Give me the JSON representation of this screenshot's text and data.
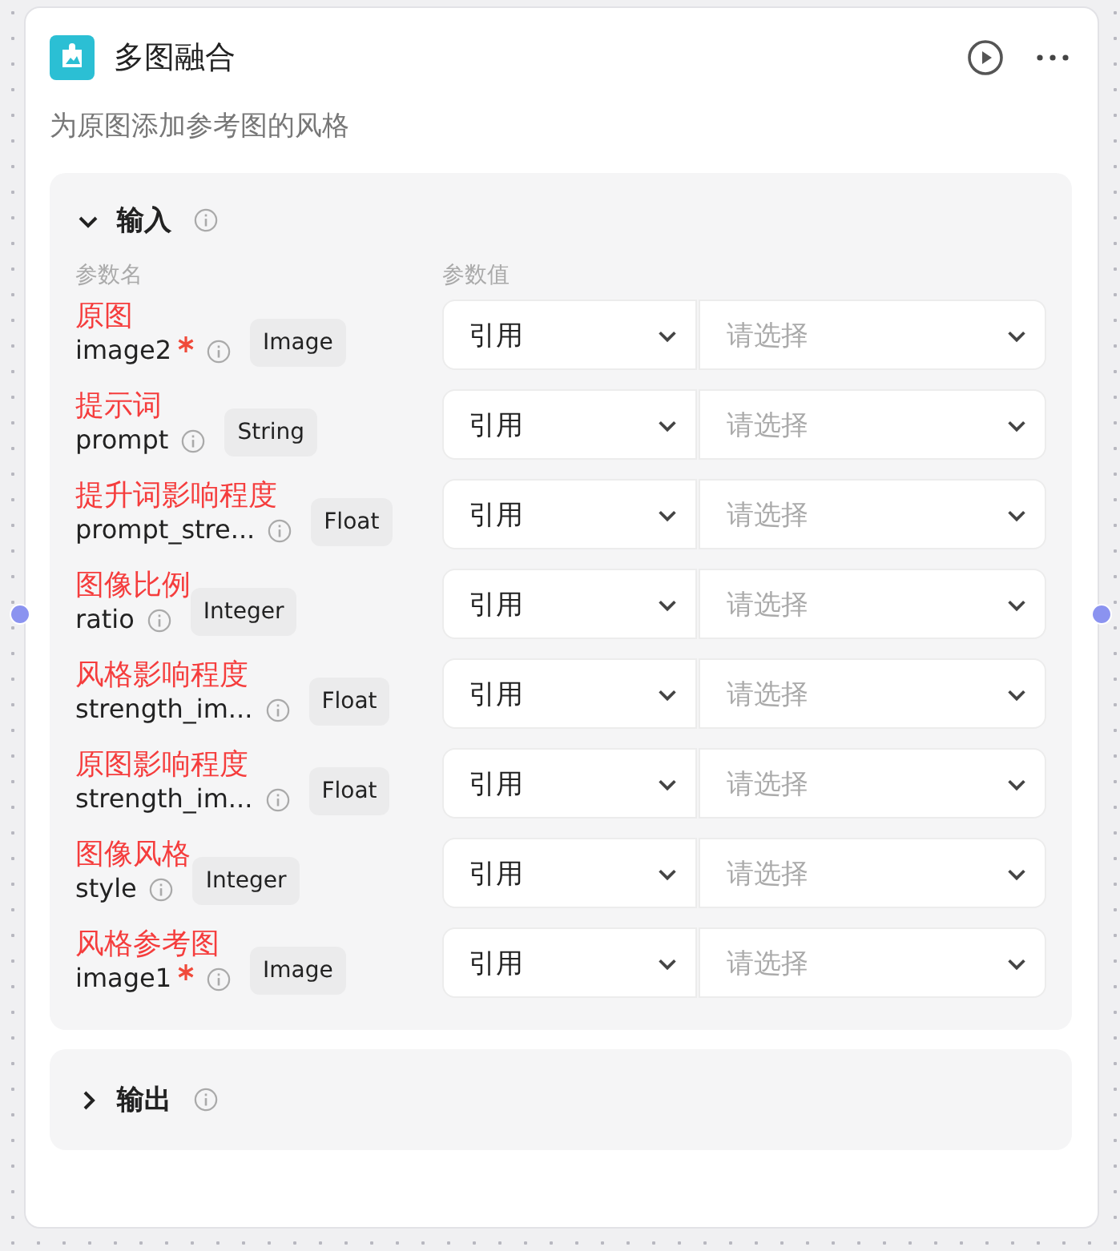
{
  "node": {
    "title": "多图融合",
    "description": "为原图添加参考图的风格"
  },
  "input_section": {
    "title": "输入",
    "expanded": true,
    "columns": [
      "参数名",
      "参数值"
    ],
    "params": [
      {
        "annotation": "原图",
        "name": "image2",
        "required": true,
        "type": "Image",
        "source": "引用",
        "placeholder": "请选择"
      },
      {
        "annotation": "提示词",
        "name": "prompt",
        "required": false,
        "type": "String",
        "source": "引用",
        "placeholder": "请选择"
      },
      {
        "annotation": "提升词影响程度",
        "name": "prompt_stre...",
        "required": false,
        "type": "Float",
        "source": "引用",
        "placeholder": "请选择"
      },
      {
        "annotation": "图像比例",
        "name": "ratio",
        "required": false,
        "type": "Integer",
        "source": "引用",
        "placeholder": "请选择"
      },
      {
        "annotation": "风格影响程度",
        "name": "strength_im...",
        "required": false,
        "type": "Float",
        "source": "引用",
        "placeholder": "请选择"
      },
      {
        "annotation": "原图影响程度",
        "name": "strength_im...",
        "required": false,
        "type": "Float",
        "source": "引用",
        "placeholder": "请选择"
      },
      {
        "annotation": "图像风格",
        "name": "style",
        "required": false,
        "type": "Integer",
        "source": "引用",
        "placeholder": "请选择"
      },
      {
        "annotation": "风格参考图",
        "name": "image1",
        "required": true,
        "type": "Image",
        "source": "引用",
        "placeholder": "请选择"
      }
    ]
  },
  "output_section": {
    "title": "输出",
    "expanded": false
  }
}
